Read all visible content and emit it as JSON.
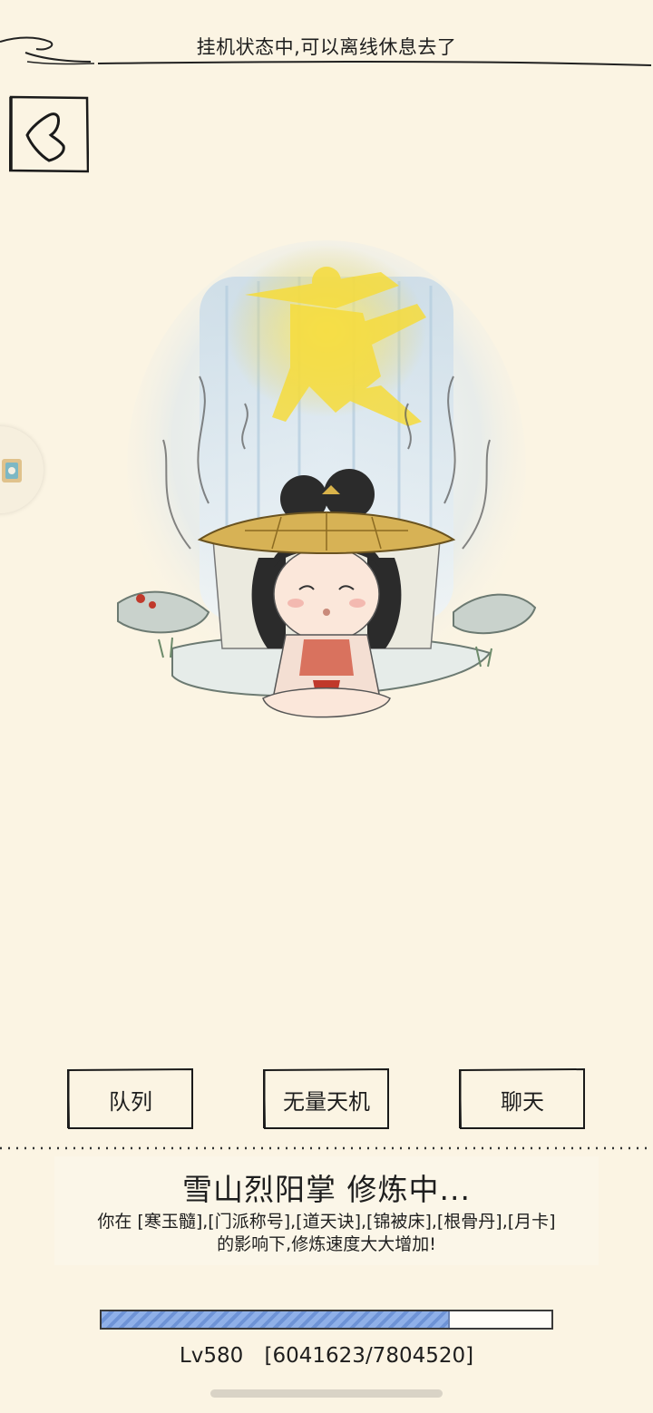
{
  "header": {
    "title": "挂机状态中,可以离线休息去了"
  },
  "nav": {
    "back_icon": "back-arrow-icon",
    "side_tab_icon": "app-badge-icon"
  },
  "actions": [
    {
      "label": "队列"
    },
    {
      "label": "无量天机"
    },
    {
      "label": "聊天"
    }
  ],
  "training": {
    "title": "雪山烈阳掌 修炼中...",
    "desc_line1": "你在 [寒玉髓],[门派称号],[道天诀],[锦被床],[根骨丹],[月卡]",
    "desc_line2": "的影响下,修炼速度大大增加!",
    "level": "Lv580",
    "exp_text": "[6041623/7804520]",
    "progress": 0.774
  },
  "colors": {
    "background": "#fbf4e3",
    "progress_fill": "#8fb0e8",
    "ink": "#1e1e1e"
  }
}
